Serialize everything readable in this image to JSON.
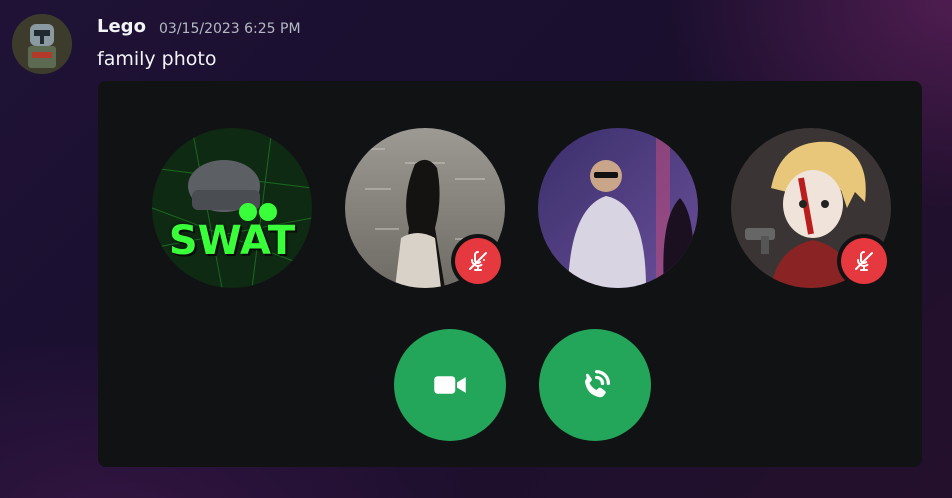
{
  "message": {
    "author": "Lego",
    "timestamp": "03/15/2023 6:25 PM",
    "text": "family photo"
  },
  "call": {
    "participants": [
      {
        "avatar": "swat-logo-avatar",
        "badge_text": "SWAT",
        "muted": false
      },
      {
        "avatar": "woman-by-water-avatar",
        "muted": true
      },
      {
        "avatar": "man-with-sunglasses-avatar",
        "muted": false
      },
      {
        "avatar": "anime-character-with-gun-avatar",
        "muted": true
      }
    ],
    "controls": [
      {
        "name": "video-call-button",
        "icon": "video-camera-icon"
      },
      {
        "name": "join-voice-call-button",
        "icon": "phone-ringing-icon"
      }
    ]
  },
  "colors": {
    "accept_green": "#23a55a",
    "muted_red": "#e5383f",
    "panel_bg": "#111214"
  }
}
